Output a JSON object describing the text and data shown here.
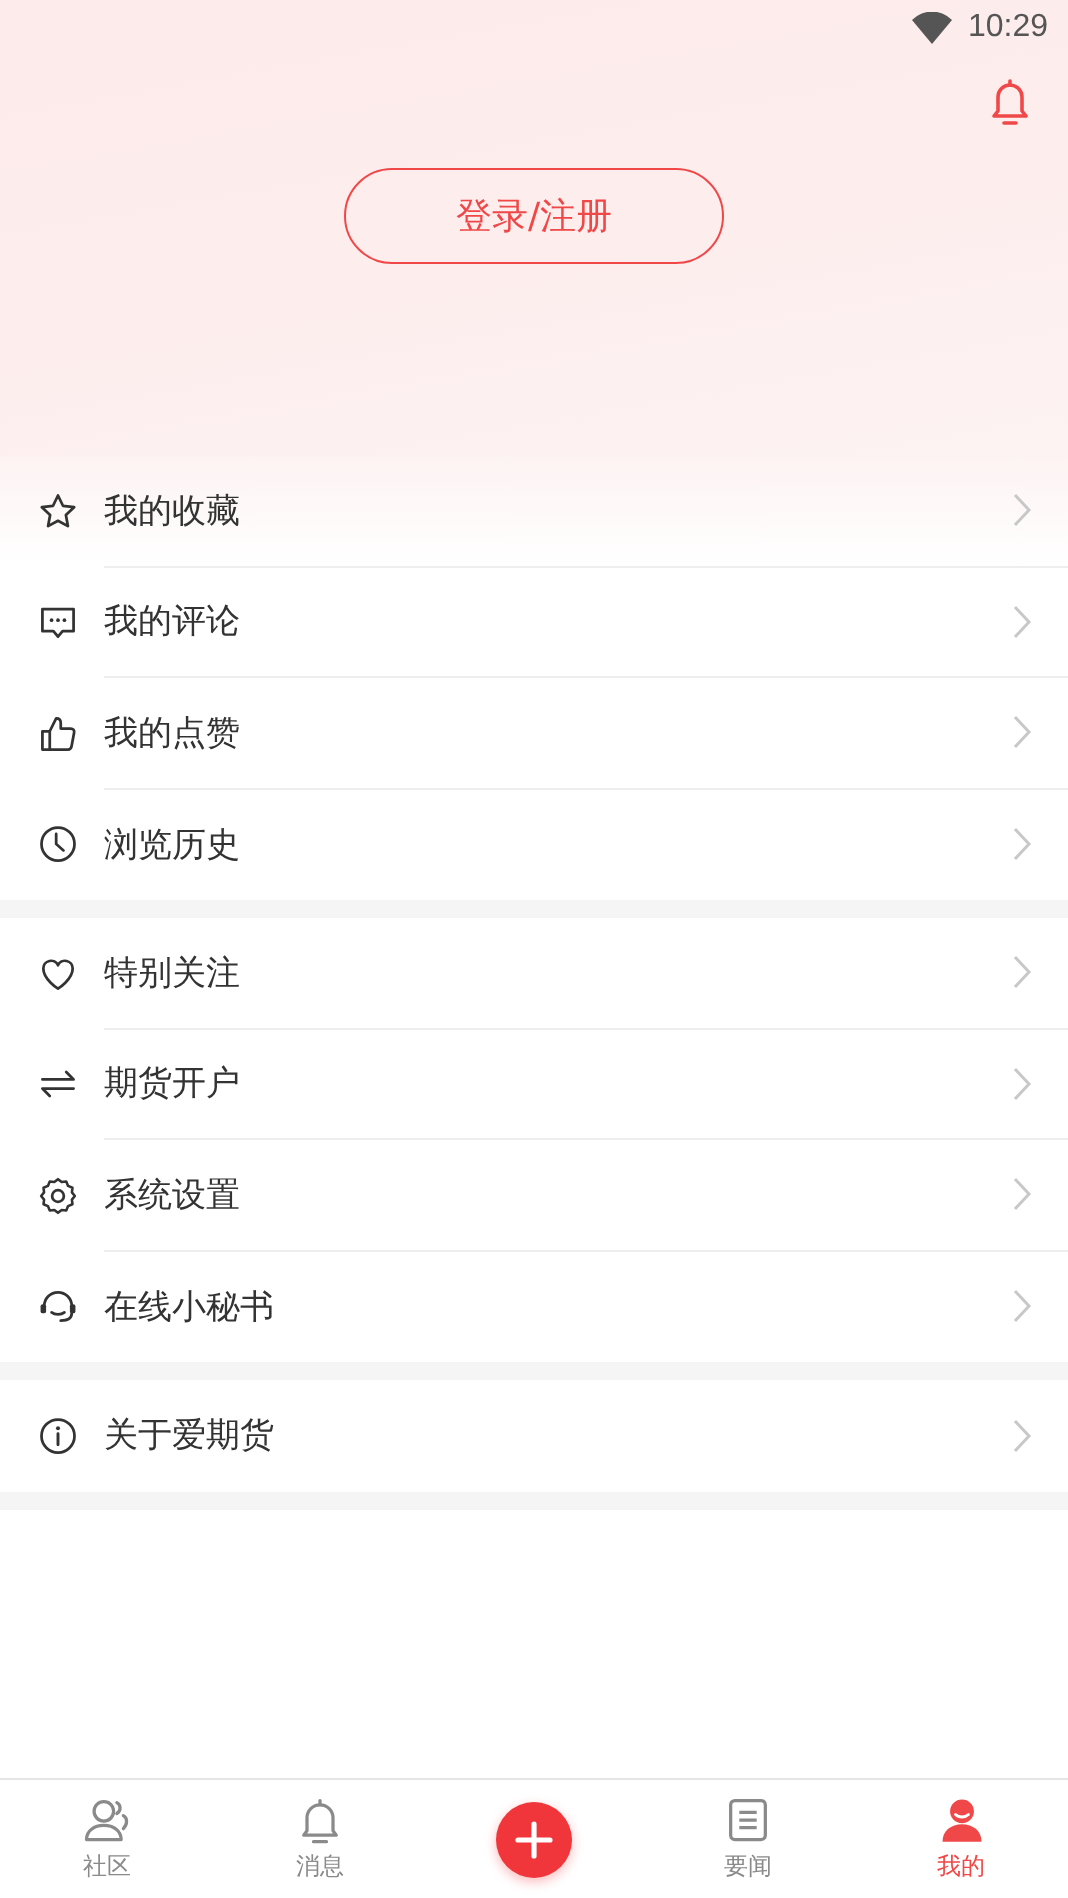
{
  "status_bar": {
    "time": "10:29"
  },
  "header": {
    "login_button": "登录/注册"
  },
  "menu_groups": [
    {
      "items": [
        {
          "label": "我的收藏"
        },
        {
          "label": "我的评论"
        },
        {
          "label": "我的点赞"
        },
        {
          "label": "浏览历史"
        }
      ]
    },
    {
      "items": [
        {
          "label": "特别关注"
        },
        {
          "label": "期货开户"
        },
        {
          "label": "系统设置"
        },
        {
          "label": "在线小秘书"
        }
      ]
    },
    {
      "items": [
        {
          "label": "关于爱期货"
        }
      ]
    }
  ],
  "bottom_nav": [
    {
      "kind": "tab",
      "label": "社区",
      "selected": false
    },
    {
      "kind": "tab",
      "label": "消息",
      "selected": false
    },
    {
      "kind": "add"
    },
    {
      "kind": "tab",
      "label": "要闻",
      "selected": false
    },
    {
      "kind": "tab",
      "label": "我的",
      "selected": true
    }
  ]
}
